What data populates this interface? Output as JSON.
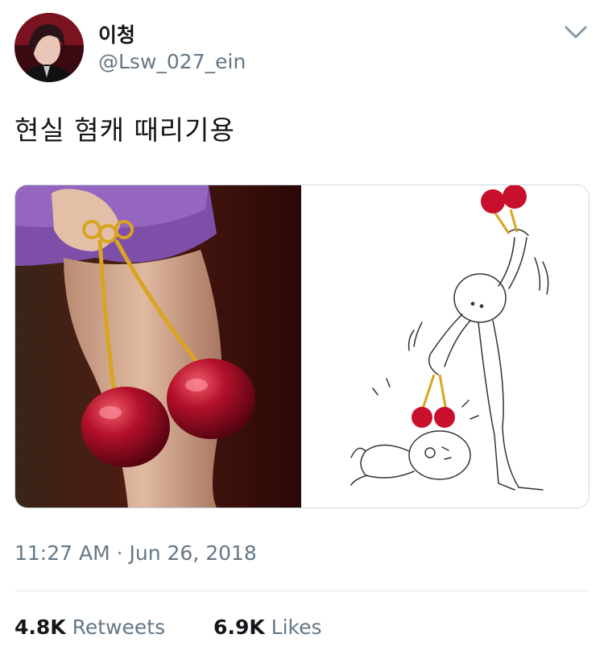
{
  "user": {
    "display_name": "이청",
    "handle": "@Lsw_027_ein"
  },
  "tweet": {
    "text": "현실 혐캐 때리기용",
    "timestamp": "11:27 AM · Jun 26, 2018"
  },
  "stats": {
    "retweets_count": "4.8K",
    "retweets_label": "Retweets",
    "likes_count": "6.9K",
    "likes_label": "Likes"
  },
  "colors": {
    "text_primary": "#14171a",
    "text_secondary": "#657786",
    "border": "#ccd6dd",
    "cherry_red": "#b3102a",
    "gold": "#d9a520"
  },
  "icons": {
    "menu": "chevron-down-icon"
  }
}
